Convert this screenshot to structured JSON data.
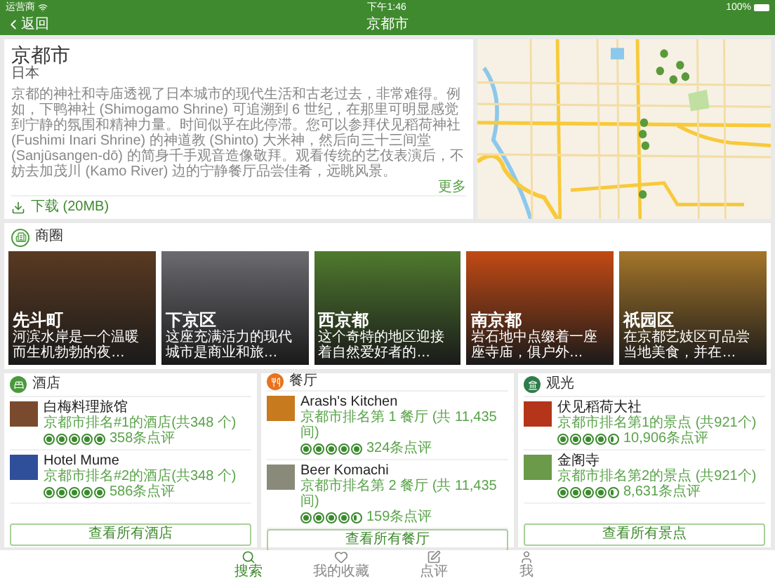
{
  "status_bar": {
    "carrier": "运营商",
    "time": "下午1:46",
    "battery": "100%"
  },
  "nav": {
    "back": "返回",
    "title": "京都市"
  },
  "overview": {
    "title": "京都市",
    "country": "日本",
    "description": "京都的神社和寺庙透视了日本城市的现代生活和古老过去，非常难得。例如，下鸭神社 (Shimogamo Shrine) 可追溯到 6 世纪，在那里可明显感觉到宁静的氛围和精神力量。时间似乎在此停滞。您可以参拜伏见稻荷神社 (Fushimi Inari Shrine) 的神道教 (Shinto) 大米神，然后向三十三间堂 (Sanjūsangen-dō) 的简身千手观音造像敬拜。观看传统的艺伎表演后，不妨去加茂川 (Kamo River) 边的宁静餐厅品尝佳肴，远眺风景。",
    "more": "更多",
    "download": "下载 (20MB)"
  },
  "areas": {
    "title": "商圈",
    "items": [
      {
        "name": "先斗町",
        "caption": "河滨水岸是一个温暖而生机勃勃的夜…",
        "color": "#5a3a22"
      },
      {
        "name": "下京区",
        "caption": "这座充满活力的现代城市是商业和旅…",
        "color": "#6b6b70"
      },
      {
        "name": "西京都",
        "caption": "这个奇特的地区迎接着自然爱好者的…",
        "color": "#4f7a2e"
      },
      {
        "name": "南京都",
        "caption": "岩石地中点缀着一座座寺庙，俱户外…",
        "color": "#c24a14"
      },
      {
        "name": "祇园区",
        "caption": "在京都艺妓区可品尝当地美食，并在…",
        "color": "#a5762a"
      }
    ]
  },
  "sections": [
    {
      "kind": "hotel",
      "title": "酒店",
      "button": "查看所有酒店",
      "items": [
        {
          "name": "白梅料理旅馆",
          "rank": "京都市排名#1的酒店(共348 个)",
          "stars": 5,
          "reviews": "358条点评"
        },
        {
          "name": "Hotel Mume",
          "rank": "京都市排名#2的酒店(共348 个)",
          "stars": 5,
          "reviews": "586条点评"
        }
      ]
    },
    {
      "kind": "restaurant",
      "title": "餐厅",
      "button": "查看所有餐厅",
      "items": [
        {
          "name": "Arash's Kitchen",
          "rank": "京都市排名第 1 餐厅 (共 11,435 间)",
          "stars": 5,
          "reviews": "324条点评"
        },
        {
          "name": "Beer Komachi",
          "rank": "京都市排名第 2 餐厅 (共 11,435 间)",
          "stars": 4.5,
          "reviews": "159条点评"
        }
      ]
    },
    {
      "kind": "attraction",
      "title": "观光",
      "button": "查看所有景点",
      "items": [
        {
          "name": "伏见稻荷大社",
          "rank": "京都市排名第1的景点 (共921个)",
          "stars": 4.5,
          "reviews": "10,906条点评"
        },
        {
          "name": "金阁寺",
          "rank": "京都市排名第2的景点 (共921个)",
          "stars": 4.5,
          "reviews": "8,631条点评"
        }
      ]
    }
  ],
  "tab_bar": [
    {
      "label": "搜索",
      "selected": true
    },
    {
      "label": "我的收藏",
      "selected": false
    },
    {
      "label": "点评",
      "selected": false
    },
    {
      "label": "我",
      "selected": false
    }
  ]
}
